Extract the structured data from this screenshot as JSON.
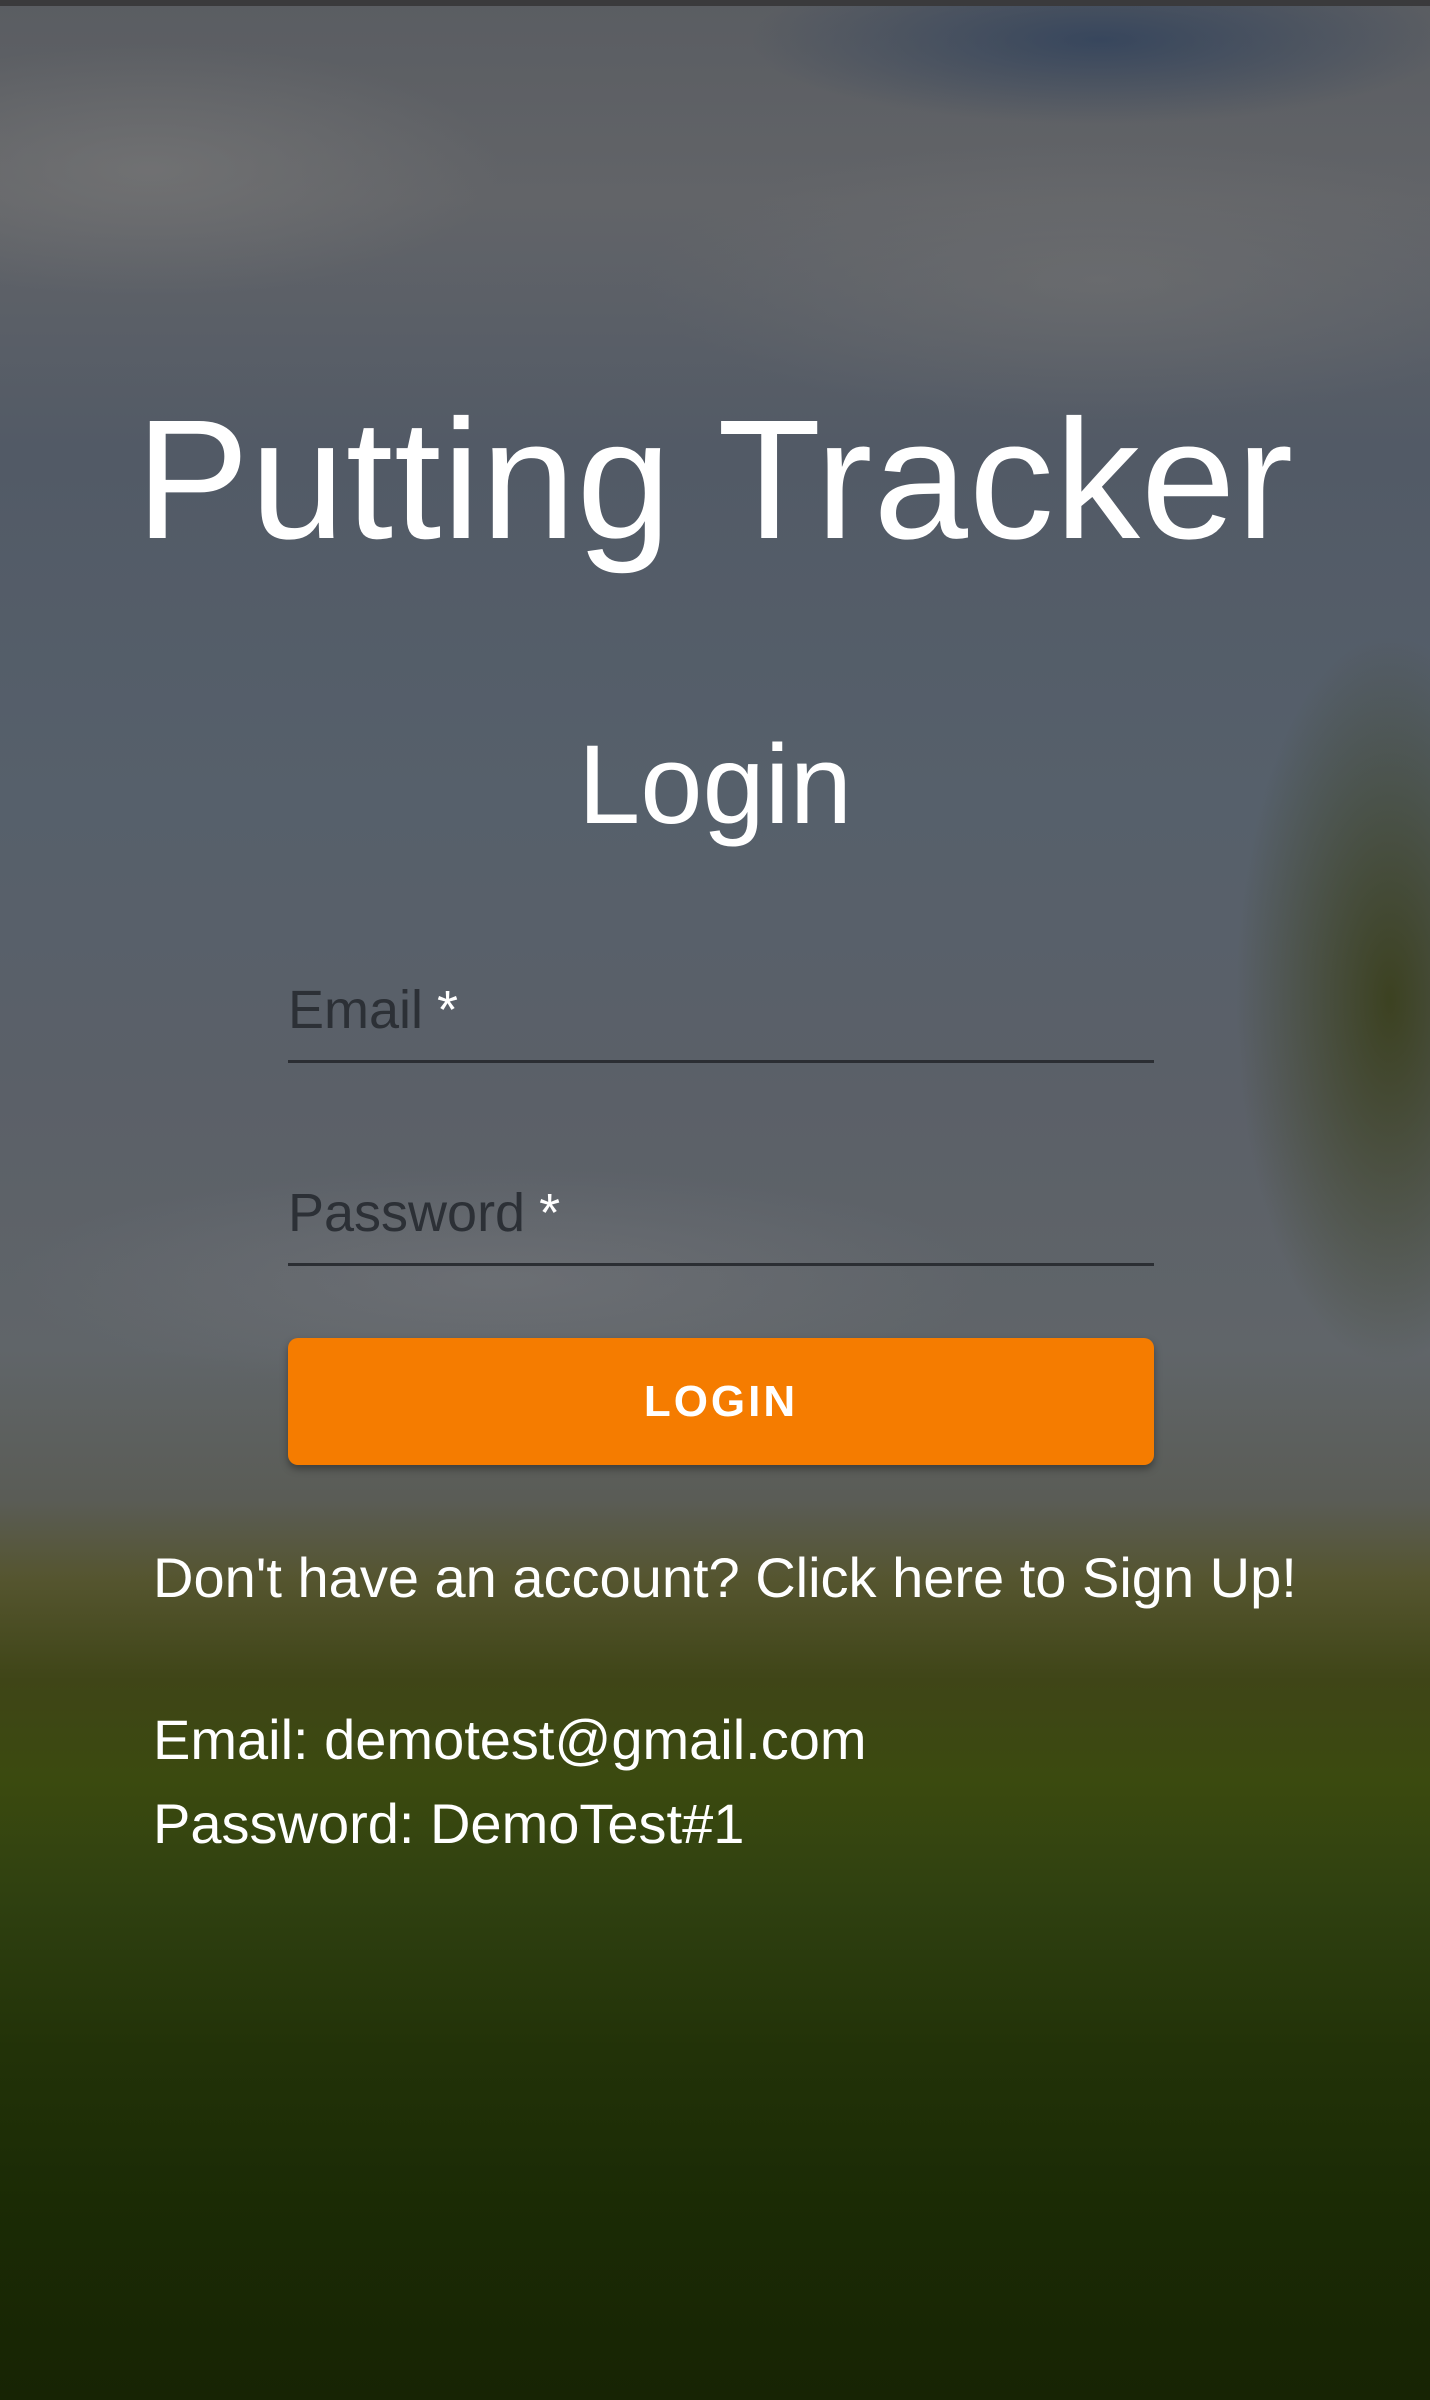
{
  "app": {
    "title": "Putting Tracker"
  },
  "login_form": {
    "heading": "Login",
    "email_label": "Email",
    "password_label": "Password",
    "required_marker": "*",
    "email_value": "",
    "password_value": "",
    "submit_label": "LOGIN",
    "signup_link": "Don't have an account? Click here to Sign Up!"
  },
  "demo_credentials": {
    "email_line": "Email: demotest@gmail.com",
    "password_line": "Password: DemoTest#1"
  },
  "colors": {
    "accent": "#f57c00",
    "text": "#ffffff",
    "input_underline": "#2b2e33"
  }
}
